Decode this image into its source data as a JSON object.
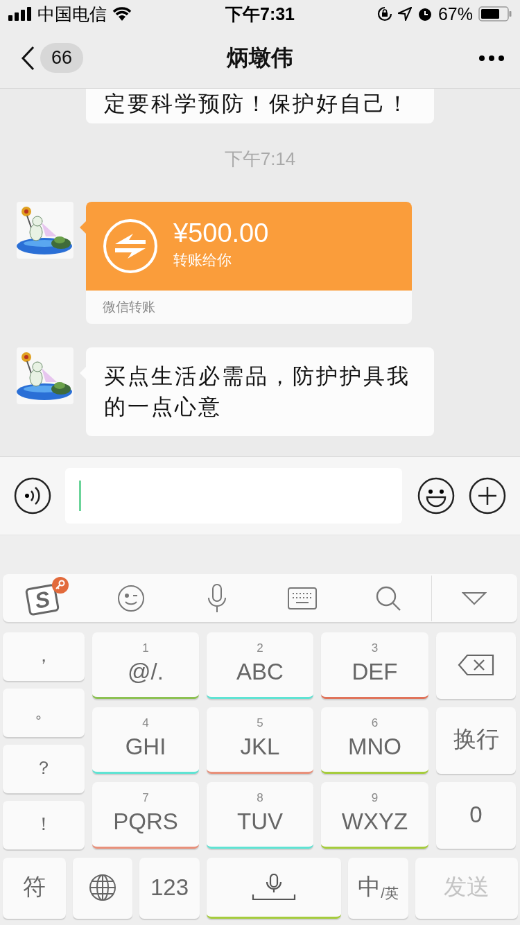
{
  "status_bar": {
    "carrier": "中国电信",
    "time": "下午7:31",
    "battery": "67%"
  },
  "nav": {
    "back_count": "66",
    "title": "炳墩伟"
  },
  "messages": [
    {
      "kind": "text",
      "avatar": false,
      "text": "定要科学预防！保护好自己！"
    },
    {
      "kind": "time",
      "text": "下午7:14"
    },
    {
      "kind": "transfer",
      "avatar": true,
      "amount": "¥500.00",
      "note": "转账给你",
      "footer": "微信转账"
    },
    {
      "kind": "text",
      "avatar": true,
      "text": "买点生活必需品，防护护具我的一点心意"
    }
  ],
  "keyboard": {
    "logo": "S",
    "side_keys": [
      "，",
      "。",
      "？",
      "！"
    ],
    "keys": [
      {
        "digit": "1",
        "letters": "@/.",
        "color": "#8cc152"
      },
      {
        "digit": "2",
        "letters": "ABC",
        "color": "#5fe3d3"
      },
      {
        "digit": "3",
        "letters": "DEF",
        "color": "#e0735a"
      },
      {
        "digit": "4",
        "letters": "GHI",
        "color": "#5fe3d3"
      },
      {
        "digit": "5",
        "letters": "JKL",
        "color": "#e8907a"
      },
      {
        "digit": "6",
        "letters": "MNO",
        "color": "#a5cc3c"
      },
      {
        "digit": "7",
        "letters": "PQRS",
        "color": "#e8907a"
      },
      {
        "digit": "8",
        "letters": "TUV",
        "color": "#5fe3d3"
      },
      {
        "digit": "9",
        "letters": "WXYZ",
        "color": "#a5cc3c"
      }
    ],
    "return_key": "换行",
    "zero": "0",
    "bottom": [
      {
        "kind": "text",
        "label": "符"
      },
      {
        "kind": "globe"
      },
      {
        "kind": "text",
        "label": "123"
      },
      {
        "kind": "space",
        "color": "#a5cc3c"
      },
      {
        "kind": "lang",
        "label": "中",
        "sub": "/英"
      },
      {
        "kind": "send",
        "label": "发送",
        "disabled": true
      }
    ]
  }
}
